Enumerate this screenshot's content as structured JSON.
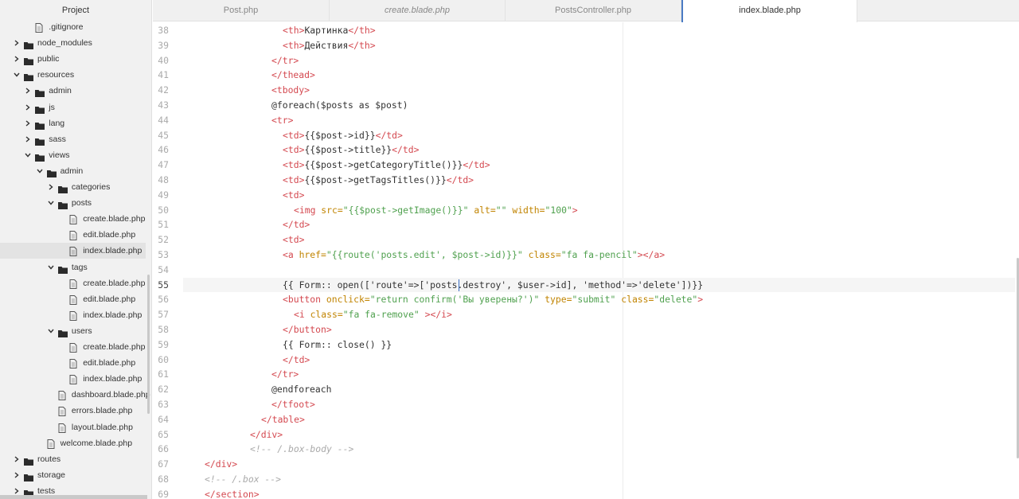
{
  "sidebar": {
    "title": "Project",
    "items": [
      {
        "label": ".gitignore",
        "type": "file",
        "depth": 1,
        "arrow": "none"
      },
      {
        "label": "node_modules",
        "type": "folder",
        "depth": 0,
        "arrow": "right"
      },
      {
        "label": "public",
        "type": "folder",
        "depth": 0,
        "arrow": "right"
      },
      {
        "label": "resources",
        "type": "folder",
        "depth": 0,
        "arrow": "down"
      },
      {
        "label": "admin",
        "type": "folder",
        "depth": 1,
        "arrow": "right"
      },
      {
        "label": "js",
        "type": "folder",
        "depth": 1,
        "arrow": "right"
      },
      {
        "label": "lang",
        "type": "folder",
        "depth": 1,
        "arrow": "right"
      },
      {
        "label": "sass",
        "type": "folder",
        "depth": 1,
        "arrow": "right"
      },
      {
        "label": "views",
        "type": "folder",
        "depth": 1,
        "arrow": "down"
      },
      {
        "label": "admin",
        "type": "folder",
        "depth": 2,
        "arrow": "down"
      },
      {
        "label": "categories",
        "type": "folder",
        "depth": 3,
        "arrow": "right"
      },
      {
        "label": "posts",
        "type": "folder",
        "depth": 3,
        "arrow": "down"
      },
      {
        "label": "create.blade.php",
        "type": "file",
        "depth": 4,
        "arrow": "none"
      },
      {
        "label": "edit.blade.php",
        "type": "file",
        "depth": 4,
        "arrow": "none"
      },
      {
        "label": "index.blade.php",
        "type": "file",
        "depth": 4,
        "arrow": "none",
        "selected": true
      },
      {
        "label": "tags",
        "type": "folder",
        "depth": 3,
        "arrow": "down"
      },
      {
        "label": "create.blade.php",
        "type": "file",
        "depth": 4,
        "arrow": "none"
      },
      {
        "label": "edit.blade.php",
        "type": "file",
        "depth": 4,
        "arrow": "none"
      },
      {
        "label": "index.blade.php",
        "type": "file",
        "depth": 4,
        "arrow": "none"
      },
      {
        "label": "users",
        "type": "folder",
        "depth": 3,
        "arrow": "down"
      },
      {
        "label": "create.blade.php",
        "type": "file",
        "depth": 4,
        "arrow": "none"
      },
      {
        "label": "edit.blade.php",
        "type": "file",
        "depth": 4,
        "arrow": "none"
      },
      {
        "label": "index.blade.php",
        "type": "file",
        "depth": 4,
        "arrow": "none"
      },
      {
        "label": "dashboard.blade.php",
        "type": "file",
        "depth": 3,
        "arrow": "none"
      },
      {
        "label": "errors.blade.php",
        "type": "file",
        "depth": 3,
        "arrow": "none"
      },
      {
        "label": "layout.blade.php",
        "type": "file",
        "depth": 3,
        "arrow": "none"
      },
      {
        "label": "welcome.blade.php",
        "type": "file",
        "depth": 2,
        "arrow": "none"
      },
      {
        "label": "routes",
        "type": "folder",
        "depth": 0,
        "arrow": "right"
      },
      {
        "label": "storage",
        "type": "folder",
        "depth": 0,
        "arrow": "right"
      },
      {
        "label": "tests",
        "type": "folder",
        "depth": 0,
        "arrow": "right"
      }
    ]
  },
  "tabs": [
    {
      "label": "Post.php",
      "italic": false,
      "active": false
    },
    {
      "label": "create.blade.php",
      "italic": true,
      "active": false
    },
    {
      "label": "PostsController.php",
      "italic": false,
      "active": false
    },
    {
      "label": "index.blade.php",
      "italic": false,
      "active": true
    }
  ],
  "editor": {
    "current_line": 55,
    "lines": [
      {
        "n": "38",
        "tokens": [
          [
            "p",
            "        "
          ],
          [
            "t",
            "<th>"
          ],
          [
            "x",
            "Картинка"
          ],
          [
            "t",
            "</th>"
          ]
        ]
      },
      {
        "n": "39",
        "tokens": [
          [
            "p",
            "        "
          ],
          [
            "t",
            "<th>"
          ],
          [
            "x",
            "Действия"
          ],
          [
            "t",
            "</th>"
          ]
        ]
      },
      {
        "n": "40",
        "tokens": [
          [
            "p",
            "      "
          ],
          [
            "t",
            "</tr>"
          ]
        ]
      },
      {
        "n": "41",
        "tokens": [
          [
            "p",
            "      "
          ],
          [
            "t",
            "</thead>"
          ]
        ]
      },
      {
        "n": "42",
        "tokens": [
          [
            "p",
            "      "
          ],
          [
            "t",
            "<tbody>"
          ]
        ]
      },
      {
        "n": "43",
        "tokens": [
          [
            "p",
            "      "
          ],
          [
            "x",
            "@foreach($posts as $post)"
          ]
        ]
      },
      {
        "n": "44",
        "tokens": [
          [
            "p",
            "      "
          ],
          [
            "t",
            "<tr>"
          ]
        ]
      },
      {
        "n": "45",
        "tokens": [
          [
            "p",
            "        "
          ],
          [
            "t",
            "<td>"
          ],
          [
            "x",
            "{{$post->id}}"
          ],
          [
            "t",
            "</td>"
          ]
        ]
      },
      {
        "n": "46",
        "tokens": [
          [
            "p",
            "        "
          ],
          [
            "t",
            "<td>"
          ],
          [
            "x",
            "{{$post->title}}"
          ],
          [
            "t",
            "</td>"
          ]
        ]
      },
      {
        "n": "47",
        "tokens": [
          [
            "p",
            "        "
          ],
          [
            "t",
            "<td>"
          ],
          [
            "x",
            "{{$post->getCategoryTitle()}}"
          ],
          [
            "t",
            "</td>"
          ]
        ]
      },
      {
        "n": "48",
        "tokens": [
          [
            "p",
            "        "
          ],
          [
            "t",
            "<td>"
          ],
          [
            "x",
            "{{$post->getTagsTitles()}}"
          ],
          [
            "t",
            "</td>"
          ]
        ]
      },
      {
        "n": "49",
        "tokens": [
          [
            "p",
            "        "
          ],
          [
            "t",
            "<td>"
          ]
        ]
      },
      {
        "n": "50",
        "tokens": [
          [
            "p",
            "          "
          ],
          [
            "t",
            "<img"
          ],
          [
            "x",
            " "
          ],
          [
            "a",
            "src="
          ],
          [
            "s",
            "\"{{$post->getImage()}}\""
          ],
          [
            "x",
            " "
          ],
          [
            "a",
            "alt="
          ],
          [
            "s",
            "\"\""
          ],
          [
            "x",
            " "
          ],
          [
            "a",
            "width="
          ],
          [
            "s",
            "\"100\""
          ],
          [
            "t",
            ">"
          ]
        ]
      },
      {
        "n": "51",
        "tokens": [
          [
            "p",
            "        "
          ],
          [
            "t",
            "</td>"
          ]
        ]
      },
      {
        "n": "52",
        "tokens": [
          [
            "p",
            "        "
          ],
          [
            "t",
            "<td>"
          ]
        ]
      },
      {
        "n": "53",
        "tokens": [
          [
            "p",
            "        "
          ],
          [
            "t",
            "<a"
          ],
          [
            "x",
            " "
          ],
          [
            "a",
            "href="
          ],
          [
            "s",
            "\"{{route('posts.edit', $post->id)}}\""
          ],
          [
            "x",
            " "
          ],
          [
            "a",
            "class="
          ],
          [
            "s",
            "\"fa fa-pencil\""
          ],
          [
            "t",
            "></a>"
          ]
        ]
      },
      {
        "n": "54",
        "tokens": []
      },
      {
        "n": "55",
        "tokens": [
          [
            "x",
            "{{ Form:: open(['route'=>['posts.destroy', $user->id], 'method'=>'delete'])}}"
          ]
        ]
      },
      {
        "n": "56",
        "tokens": [
          [
            "p",
            "        "
          ],
          [
            "t",
            "<button"
          ],
          [
            "x",
            " "
          ],
          [
            "a",
            "onclick="
          ],
          [
            "s",
            "\"return confirm('Вы уверены?')\""
          ],
          [
            "x",
            " "
          ],
          [
            "a",
            "type="
          ],
          [
            "s",
            "\"submit\""
          ],
          [
            "x",
            " "
          ],
          [
            "a",
            "class="
          ],
          [
            "s",
            "\"delete\""
          ],
          [
            "t",
            ">"
          ]
        ]
      },
      {
        "n": "57",
        "tokens": [
          [
            "p",
            "          "
          ],
          [
            "t",
            "<i"
          ],
          [
            "x",
            " "
          ],
          [
            "a",
            "class="
          ],
          [
            "s",
            "\"fa fa-remove\""
          ],
          [
            "x",
            " "
          ],
          [
            "t",
            "></i>"
          ]
        ]
      },
      {
        "n": "58",
        "tokens": [
          [
            "p",
            "        "
          ],
          [
            "t",
            "</button>"
          ]
        ]
      },
      {
        "n": "59",
        "tokens": [
          [
            "p",
            "        "
          ],
          [
            "x",
            "{{ Form:: close() }}"
          ]
        ]
      },
      {
        "n": "60",
        "tokens": [
          [
            "p",
            "        "
          ],
          [
            "t",
            "</td>"
          ]
        ]
      },
      {
        "n": "61",
        "tokens": [
          [
            "p",
            "      "
          ],
          [
            "t",
            "</tr>"
          ]
        ]
      },
      {
        "n": "62",
        "tokens": [
          [
            "p",
            "      "
          ],
          [
            "x",
            "@endforeach"
          ]
        ]
      },
      {
        "n": "63",
        "tokens": [
          [
            "p",
            "      "
          ],
          [
            "t",
            "</tfoot>"
          ]
        ]
      },
      {
        "n": "64",
        "tokens": [
          [
            "p",
            "    "
          ],
          [
            "t",
            "</table>"
          ]
        ]
      },
      {
        "n": "65",
        "tokens": [
          [
            "p",
            "  "
          ],
          [
            "t",
            "</div>"
          ]
        ]
      },
      {
        "n": "66",
        "tokens": [
          [
            "p",
            "  "
          ],
          [
            "c",
            "<!-- /.box-body -->"
          ]
        ]
      },
      {
        "n": "67",
        "tokens": [
          [
            "t",
            "</div>"
          ]
        ]
      },
      {
        "n": "68",
        "tokens": [
          [
            "c",
            "<!-- /.box -->"
          ]
        ]
      },
      {
        "n": "69",
        "tokens": [
          [
            "t",
            "</section>"
          ]
        ]
      }
    ]
  },
  "colors": {
    "tag": "#d44950",
    "attr": "#c18401",
    "string": "#50a14f",
    "comment": "#aaaaaa",
    "text": "#333333",
    "active_tab_marker": "#4a7bc4",
    "sidebar_bg": "#f1f1f1"
  },
  "icons": {
    "folder": "folder-icon",
    "file": "file-icon",
    "collapsed": "chevron-right-icon",
    "expanded": "chevron-down-icon"
  }
}
